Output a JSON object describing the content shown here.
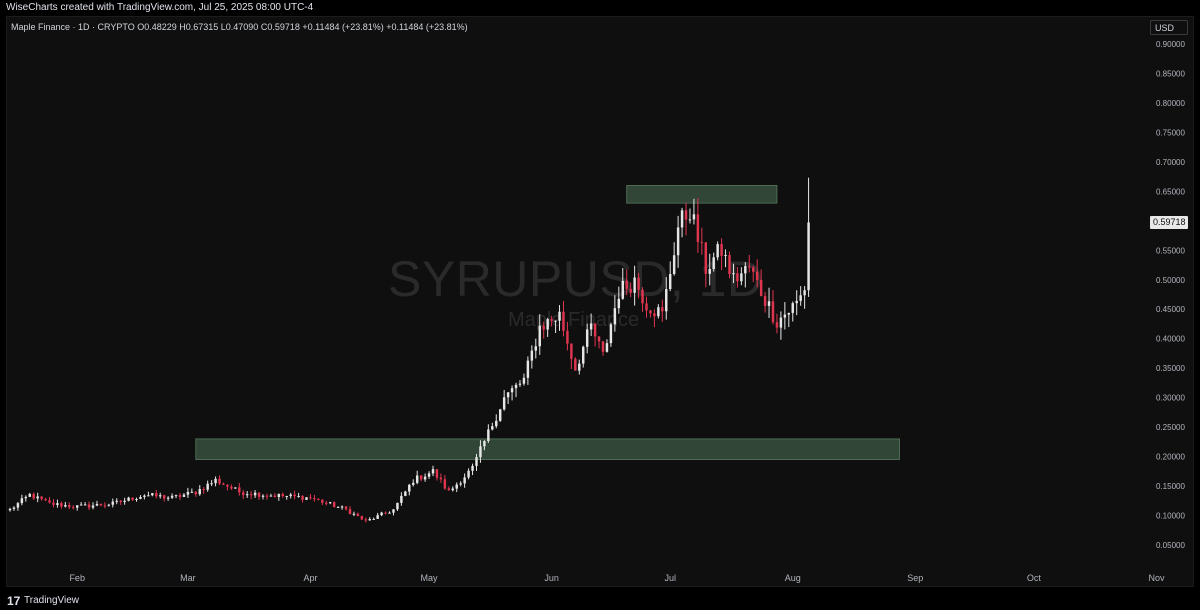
{
  "header": {
    "attribution": "WiseCharts created with TradingView.com, Jul 25, 2025 08:00 UTC-4"
  },
  "legend": {
    "text": "Maple Finance · 1D · CRYPTO  O0.48229  H0.67315  L0.47090  C0.59718  +0.11484 (+23.81%)  +0.11484 (+23.81%)"
  },
  "watermark": {
    "symbol": "SYRUPUSD, 1D",
    "name": "Maple Finance"
  },
  "currency": "USD",
  "last_price_label": "0.59718",
  "footer": {
    "logo": "17",
    "brand": "TradingView"
  },
  "colors": {
    "up": "#e6e6e6",
    "down": "#e0354f",
    "zone": "#3d5a45",
    "zone_border": "#587a5f"
  },
  "chart_data": {
    "type": "candlestick",
    "symbol": "SYRUPUSD",
    "interval": "1D",
    "x_axis": {
      "ticks": [
        "Feb",
        "Mar",
        "Apr",
        "May",
        "Jun",
        "Jul",
        "Aug",
        "Sep",
        "Oct",
        "Nov"
      ],
      "range": [
        "2025-01-15",
        "2025-11-13"
      ]
    },
    "y_axis": {
      "range": [
        0.02,
        0.92
      ],
      "ticks": [
        "0.90000",
        "0.85000",
        "0.80000",
        "0.75000",
        "0.70000",
        "0.65000",
        "0.60000",
        "0.55000",
        "0.50000",
        "0.45000",
        "0.40000",
        "0.35000",
        "0.30000",
        "0.25000",
        "0.20000",
        "0.15000",
        "0.10000",
        "0.05000"
      ]
    },
    "zones": [
      {
        "start": "2025-03-03",
        "end": "2025-08-28",
        "low": 0.195,
        "high": 0.23
      },
      {
        "start": "2025-06-20",
        "end": "2025-07-28",
        "low": 0.63,
        "high": 0.66
      }
    ],
    "last_close": 0.59718,
    "anchors": [
      [
        "2025-01-15",
        0.11
      ],
      [
        "2025-01-20",
        0.135
      ],
      [
        "2025-01-25",
        0.12
      ],
      [
        "2025-02-01",
        0.115
      ],
      [
        "2025-02-10",
        0.12
      ],
      [
        "2025-02-18",
        0.135
      ],
      [
        "2025-02-25",
        0.13
      ],
      [
        "2025-03-03",
        0.14
      ],
      [
        "2025-03-08",
        0.16
      ],
      [
        "2025-03-14",
        0.14
      ],
      [
        "2025-03-21",
        0.135
      ],
      [
        "2025-04-01",
        0.13
      ],
      [
        "2025-04-10",
        0.11
      ],
      [
        "2025-04-15",
        0.09
      ],
      [
        "2025-04-22",
        0.11
      ],
      [
        "2025-04-27",
        0.16
      ],
      [
        "2025-05-02",
        0.175
      ],
      [
        "2025-05-06",
        0.14
      ],
      [
        "2025-05-12",
        0.18
      ],
      [
        "2025-05-16",
        0.24
      ],
      [
        "2025-05-20",
        0.3
      ],
      [
        "2025-05-25",
        0.33
      ],
      [
        "2025-05-29",
        0.42
      ],
      [
        "2025-06-03",
        0.44
      ],
      [
        "2025-06-07",
        0.35
      ],
      [
        "2025-06-11",
        0.42
      ],
      [
        "2025-06-14",
        0.37
      ],
      [
        "2025-06-18",
        0.48
      ],
      [
        "2025-06-22",
        0.5
      ],
      [
        "2025-06-25",
        0.46
      ],
      [
        "2025-06-29",
        0.44
      ],
      [
        "2025-07-03",
        0.59
      ],
      [
        "2025-07-06",
        0.62
      ],
      [
        "2025-07-10",
        0.52
      ],
      [
        "2025-07-14",
        0.55
      ],
      [
        "2025-07-17",
        0.5
      ],
      [
        "2025-07-21",
        0.52
      ],
      [
        "2025-07-24",
        0.48
      ],
      [
        "2025-07-28",
        0.43
      ],
      [
        "2025-08-02",
        0.46
      ],
      [
        "2025-08-04",
        0.48229
      ]
    ],
    "final_candle": {
      "date": "2025-08-05",
      "open": 0.48229,
      "high": 0.67315,
      "low": 0.4709,
      "close": 0.59718
    }
  }
}
